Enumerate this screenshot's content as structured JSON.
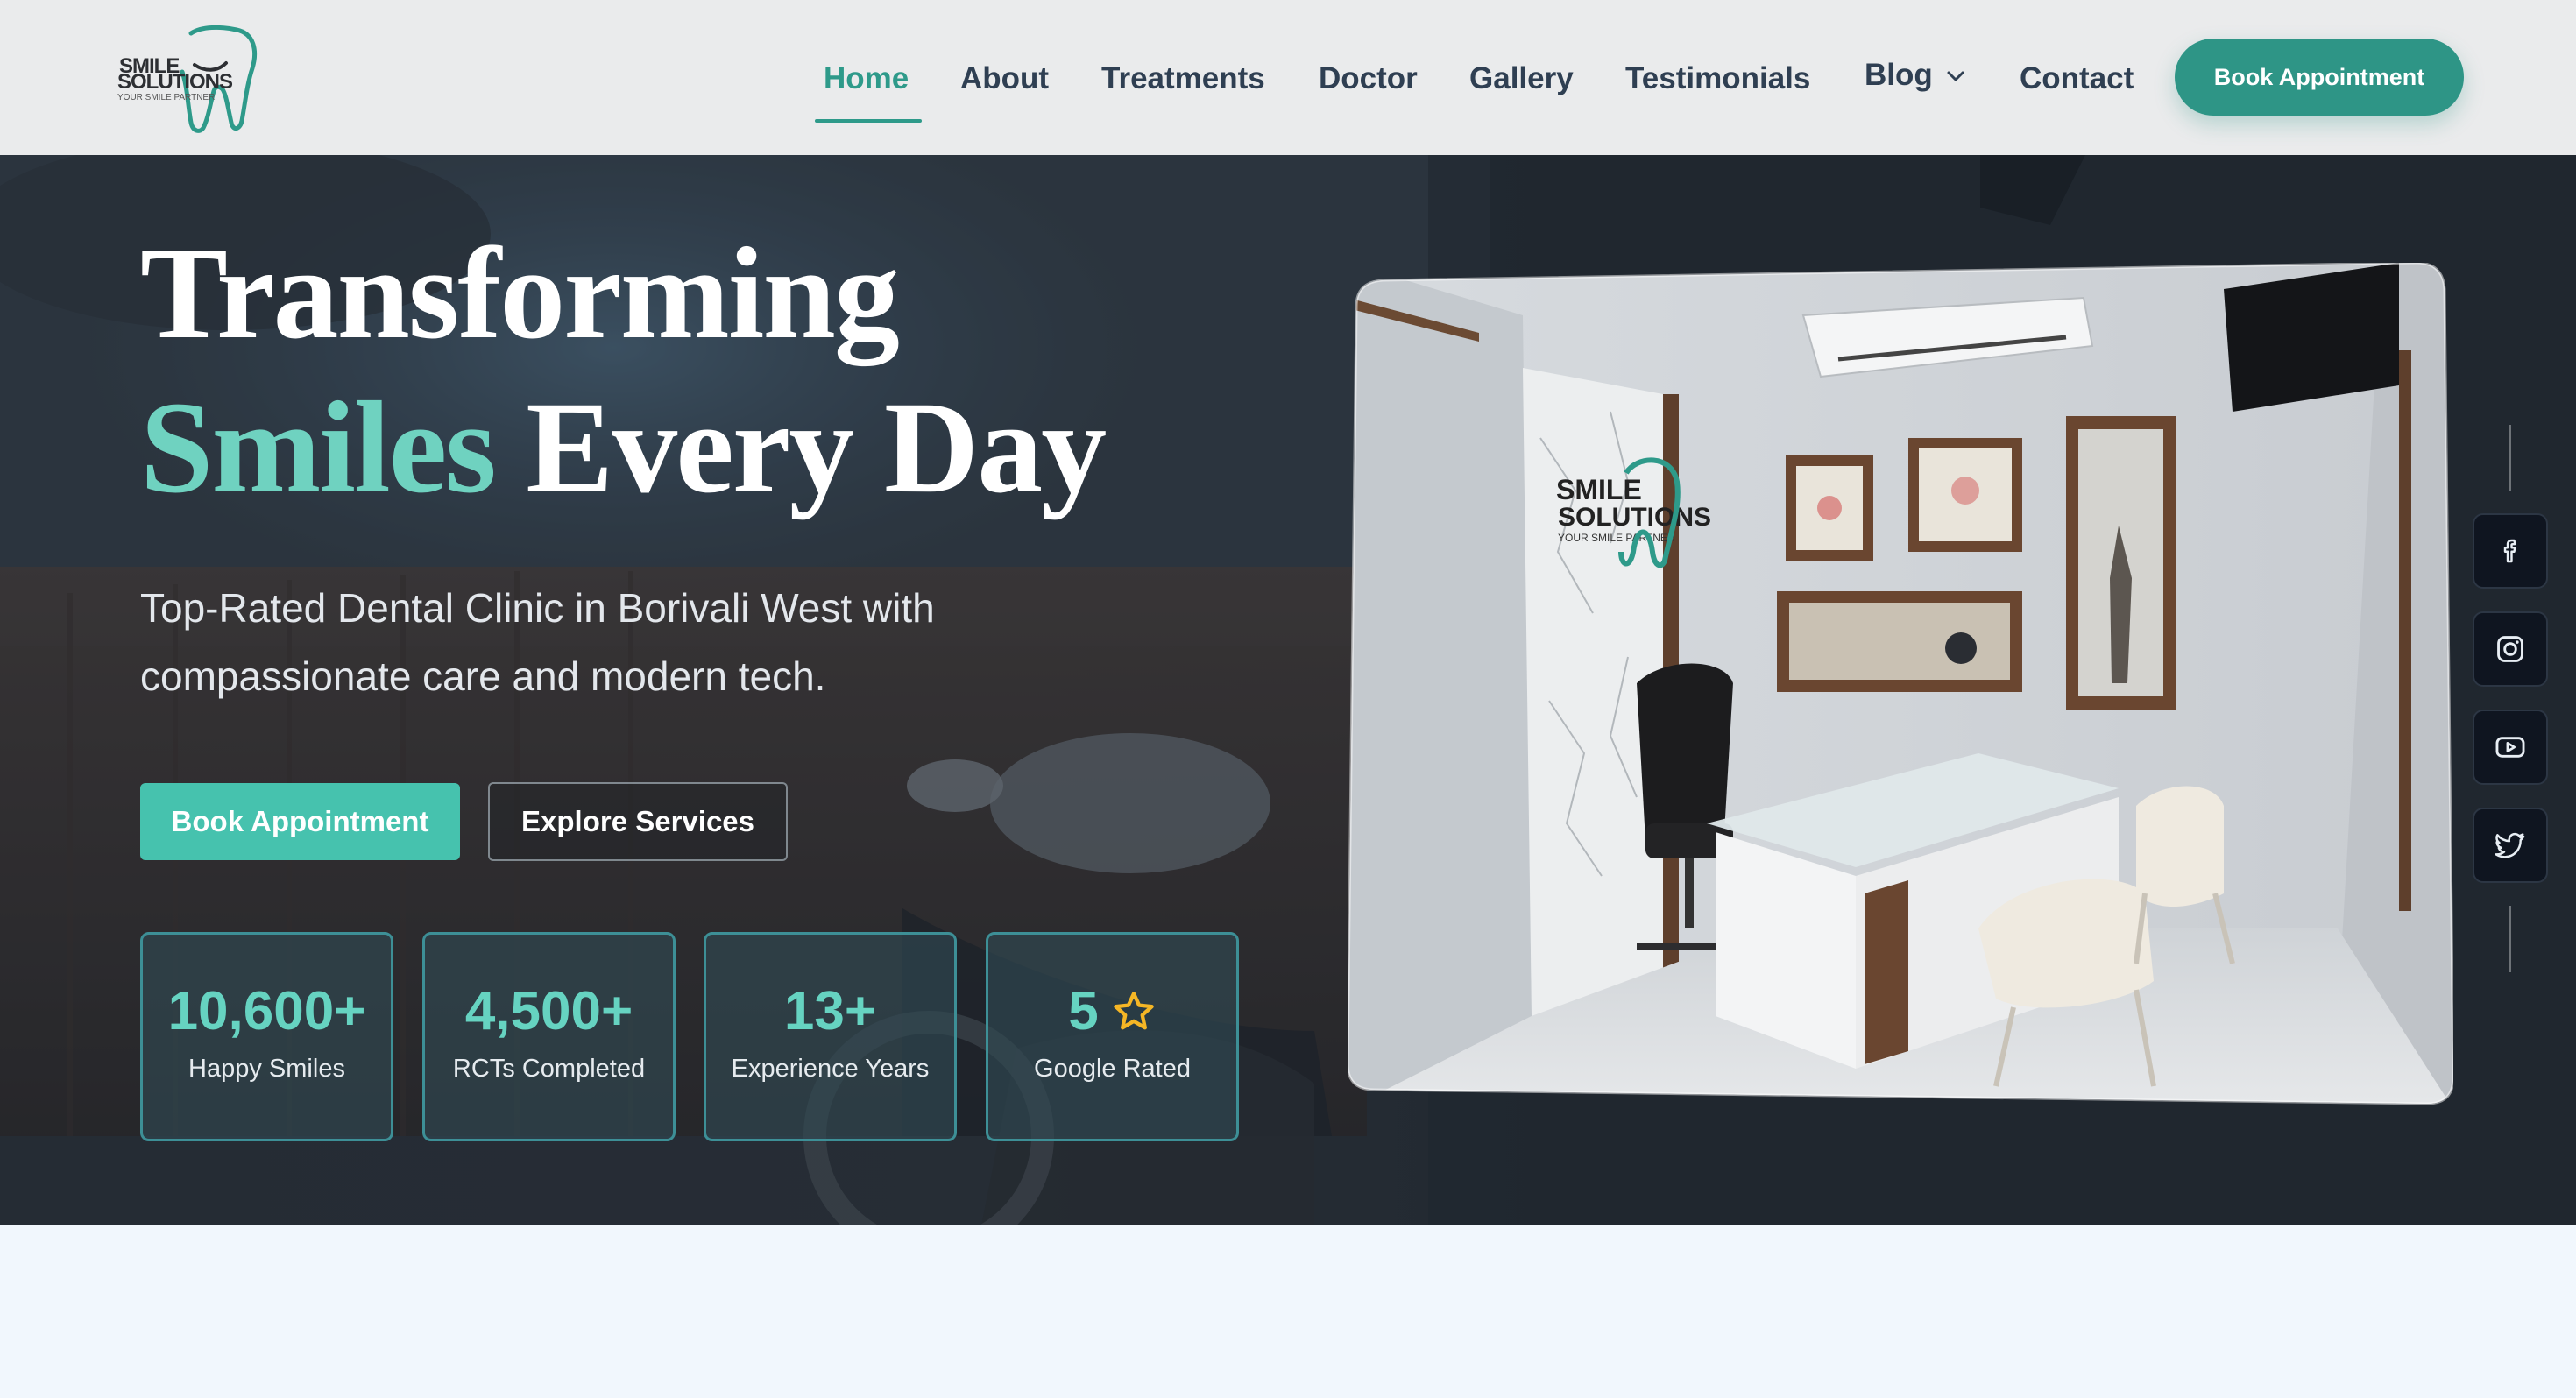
{
  "brand": {
    "line1": "SMILE",
    "line2": "SOLUTIONS",
    "tagline": "YOUR SMILE PARTNER",
    "accent_color": "#2e9a8a"
  },
  "nav": {
    "items": [
      {
        "label": "Home",
        "active": true
      },
      {
        "label": "About"
      },
      {
        "label": "Treatments"
      },
      {
        "label": "Doctor"
      },
      {
        "label": "Gallery"
      },
      {
        "label": "Testimonials"
      },
      {
        "label": "Blog"
      },
      {
        "label": "Contact"
      }
    ],
    "book_label": "Book Appointment"
  },
  "hero": {
    "title_line1": "Transforming",
    "title_accent": "Smiles",
    "title_rest": " Every Day",
    "subtitle": "Top-Rated Dental Clinic in Borivali West with compassionate care and modern tech.",
    "primary_button": "Book Appointment",
    "secondary_button": "Explore Services",
    "stats": [
      {
        "value": "10,600+",
        "label": "Happy Smiles"
      },
      {
        "value": "4,500+",
        "label": "RCTs Completed"
      },
      {
        "value": "13+",
        "label": "Experience Years"
      },
      {
        "value": "5",
        "label": "Google Rated",
        "icon": "star-icon"
      }
    ],
    "photo_sign_line1": "SMILE",
    "photo_sign_line2": "SOLUTIONS",
    "photo_sign_tagline": "YOUR SMILE PARTNER"
  },
  "social": [
    "facebook-icon",
    "instagram-icon",
    "youtube-icon",
    "twitter-icon"
  ]
}
